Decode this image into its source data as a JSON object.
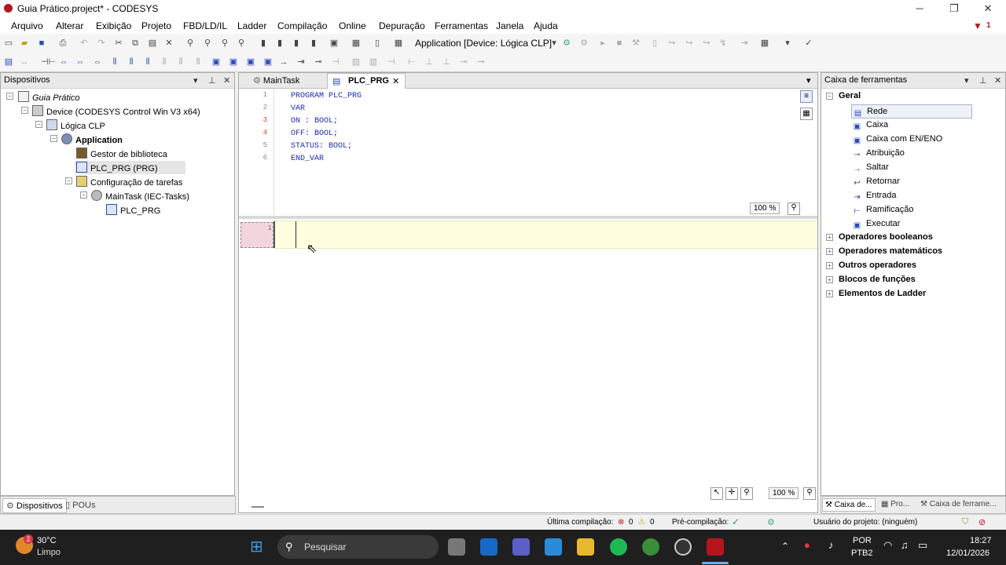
{
  "window": {
    "title": "Guia Prático.project* - CODESYS",
    "minimize": "─",
    "restore": "❐",
    "close": "✕"
  },
  "menu": [
    "Arquivo",
    "Alterar",
    "Exibição",
    "Projeto",
    "FBD/LD/IL",
    "Ladder",
    "Compilação",
    "Online",
    "Depuração",
    "Ferramentas",
    "Janela",
    "Ajuda"
  ],
  "menu_badge": "1",
  "toolbar": {
    "app_selector": "Application [Device: Lógica CLP]"
  },
  "devices": {
    "title": "Dispositivos",
    "tree": [
      {
        "label": "Guia Prático",
        "italic": true
      },
      {
        "label": "Device (CODESYS Control Win V3 x64)"
      },
      {
        "label": "Lógica CLP"
      },
      {
        "label": "Application",
        "bold": true
      },
      {
        "label": "Gestor de biblioteca"
      },
      {
        "label": "PLC_PRG (PRG)",
        "selected": true
      },
      {
        "label": "Configuração de tarefas"
      },
      {
        "label": "MainTask (IEC-Tasks)"
      },
      {
        "label": "PLC_PRG"
      }
    ],
    "bottom_tabs": [
      "Dispositivos",
      "POUs"
    ]
  },
  "editor": {
    "tabs": [
      {
        "label": "MainTask"
      },
      {
        "label": "PLC_PRG",
        "active": true
      }
    ],
    "declaration_lines": [
      "PROGRAM PLC_PRG",
      "VAR",
      "ON : BOOL;",
      "OFF: BOOL;",
      "STATUS: BOOL;",
      "END_VAR"
    ],
    "line_numbers": [
      "1",
      "2",
      "3",
      "4",
      "5",
      "6"
    ],
    "zoom_top": "100 %",
    "network_number": "1",
    "zoom_bottom": "100 %"
  },
  "toolbox": {
    "title": "Caixa de ferramentas",
    "group_open": "Geral",
    "items": [
      {
        "label": "Rede",
        "icon": "network-icon",
        "selected": true
      },
      {
        "label": "Caixa",
        "icon": "box-icon"
      },
      {
        "label": "Caixa com EN/ENO",
        "icon": "box-en-icon"
      },
      {
        "label": "Atribuição",
        "icon": "assign-icon"
      },
      {
        "label": "Saltar",
        "icon": "jump-icon"
      },
      {
        "label": "Retornar",
        "icon": "return-icon"
      },
      {
        "label": "Entrada",
        "icon": "input-icon"
      },
      {
        "label": "Ramificação",
        "icon": "branch-icon"
      },
      {
        "label": "Executar",
        "icon": "execute-icon"
      }
    ],
    "groups": [
      "Operadores booleanos",
      "Operadores matemáticos",
      "Outros operadores",
      "Blocos de funções",
      "Elementos de Ladder"
    ],
    "bottom_tabs": [
      "Caixa de...",
      "Pro...",
      "Caixa de ferrame..."
    ]
  },
  "status": {
    "last_compile": "Última compilação:",
    "errors": "0",
    "warnings": "0",
    "precompile": "Pré-compilação:",
    "user": "Usuário do projeto: (ninguém)"
  },
  "taskbar": {
    "weather_temp": "30°C",
    "weather_desc": "Limpo",
    "weather_badge": "2",
    "search": "Pesquisar",
    "lang1": "POR",
    "lang2": "PTB2",
    "time": "18:27",
    "date": "12/01/2026"
  },
  "colors": {
    "accent": "#1b2bb5",
    "codesys_red": "#b8141d",
    "ladder_bg": "#ffffe0"
  }
}
